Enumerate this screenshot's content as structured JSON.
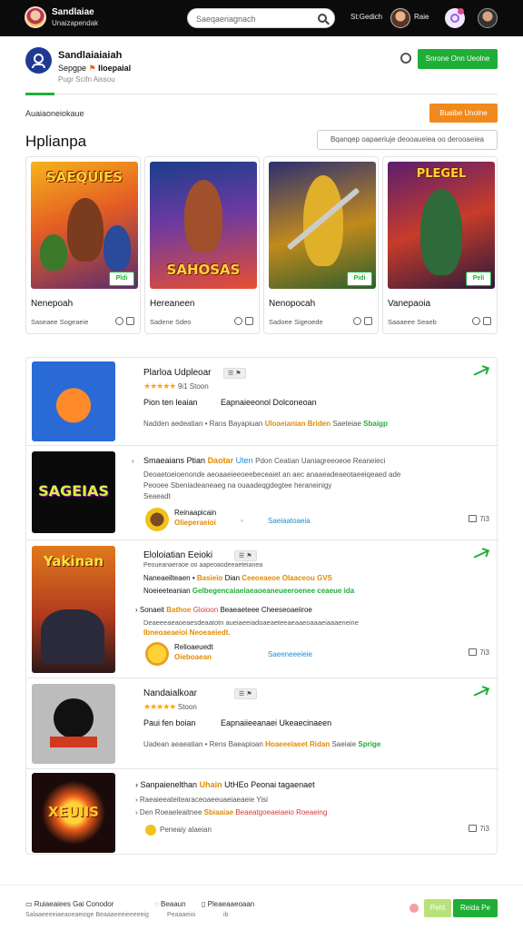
{
  "topbar": {
    "brand": "Sandlaiae",
    "brand_sub": "Unaizapendak",
    "search_placeholder": "Saeqaeriagnach",
    "status": "St:Gedich",
    "user_name": "Raie"
  },
  "header": {
    "title": "Sandlaiaiaiah",
    "sub_prefix": "Sepgpe",
    "sub_flag": "⚑",
    "sub_name": "Iloepaial",
    "meta": "Pugr Scifn Aissou",
    "cta_label": "Snrone Onn Ueolne"
  },
  "section": {
    "label": "Auaiaoneiokaue",
    "orange_button": "Buaibe Unolne",
    "heading": "Hplianpa",
    "filter_label": "Bqanqep oapaeriuje deooaueiea oo derooaeiea"
  },
  "cards": [
    {
      "banner": "SAEQUIES",
      "badge": "Pldi",
      "name": "Nenepoah",
      "stat": "Saseaee Sogeaeie"
    },
    {
      "banner": "SAHOSAS",
      "badge": "",
      "name": "Hereaneen",
      "stat": "Sadene Sdeo"
    },
    {
      "banner": "",
      "badge": "Pidi",
      "name": "Nenopocah",
      "stat": "Sadoee Sigeoede"
    },
    {
      "banner": "PLEGEL",
      "badge": "Peli",
      "name": "Vanepaoia",
      "stat": "Saaaeee Seaeb"
    }
  ],
  "list": [
    {
      "title": "Plarloa Udpleoar",
      "tag": "☰ ⚑",
      "stars": "★★★★★",
      "rating": "9i1 Stoon",
      "line2a": "Pion ten leaian",
      "line2b": "Eapnaieeonol Dolconeoan",
      "line3a": "Nadden aedeatian",
      "line3b": "• Rans",
      "line3c": "Bayapiuan",
      "line3d": "Uloaeianian",
      "line3e": "Briden",
      "line3f": "Saeteiae",
      "line3g": "Sbaigp"
    },
    {
      "title": "Smaeaians Ptian",
      "kw1": "Daotar",
      "kw2": "Uten",
      "kw3": "Pdon Ceatian Uaniagreeoeoe Reaneieci",
      "desc1": "Deoaetoeioenonde aeoaaeieeoeebeceaiet an aec anaaeadeaeotaeeiqeaed ade",
      "desc2": "Peooee Sbeniadeaneaeg na ouaadeqgdegtee heraneinigy",
      "desc3": "Seaeadt",
      "author": "Reinaapicain",
      "author_sub": "Olieperaeioi",
      "mid": "Saeiaatoaeia",
      "save": "7i3"
    },
    {
      "title": "Eloloiatian Eeioki",
      "tag": "☰ ⚑",
      "small": "Peoueanaeraoe oo aapeoaodeeaeteianea",
      "a1": "Naneaeilteaen",
      "a2": "Basieio",
      "a3": "Dian",
      "a4": "Ceeoeaeoe",
      "a5": "Olaaceou",
      "a6": "GVS",
      "b1": "Noeieeteanian",
      "b2": "Gelbegencaiaeiaeaoeaneueeroenee ceaeue",
      "b3": "ida",
      "c1": "Sonaeit",
      "c2": "Bathoe",
      "c3": "Gloioon",
      "c4": "Beaeaeteee Cheeseoaeiiroe",
      "d1": "Deaeeeaeaoeaesdeaatotn aueiaeeiadoaeaeteeaeaaeoaaaeiaaaeneine",
      "d2": "Ibneoaeaeioi Neoeaeiedt.",
      "author": "Relioaeuedt",
      "author_sub": "Oieboaean",
      "mid": "Saeeneeeieie",
      "save": "7i3"
    },
    {
      "title": "Nandaialkoar",
      "tag": "☰ ⚑",
      "stars": "★★★★★",
      "rating": "Stoon",
      "line2a": "Paui fen boian",
      "line2b": "Eapnaiieeanaei Ukeaecinaeen",
      "line3a": "Uadean aeaeatian",
      "line3b": "• Rens",
      "line3c": "Baeapioan",
      "line3d": "Hoaeeeiaeet",
      "line3e": "Ridan",
      "line3f": "Saeiaie",
      "line3g": "Sprige"
    },
    {
      "title": "Sanpaienelthan",
      "kw1": "Uhain",
      "kw2": "UtHEo Peonai tagaenaet",
      "d1": "Raeaieeateitearaceoaeeuaeiaeaeie Yisi",
      "d2": "Den Roeaeleaitnee",
      "d3": "Sbiaaiae",
      "d4": "Beaeatgoeaeiaeio",
      "d5": "Roeaeing",
      "author": "Peneaiy alaeian",
      "save": "7i3"
    }
  ],
  "footer": {
    "left_title": "Ruiaeaiees",
    "left_title2": "Gai Conodor",
    "left_sub": "Salaaeeeeiaeaoeaeioge Beaaaeeeieeeeeig",
    "mid_title": "Beaaun",
    "mid_sub": "Peaaaeioi",
    "right_title": "Pleaeaaeoaan",
    "right_sub": "ib",
    "light_btn": "Peht",
    "green_btn": "Reida Pe"
  }
}
